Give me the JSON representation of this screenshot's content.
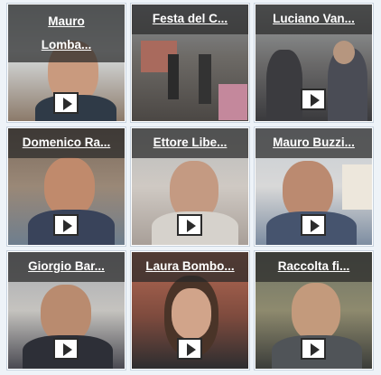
{
  "videos": [
    {
      "title": "Mauro Lomba...",
      "icon": "play-icon"
    },
    {
      "title": "Festa del C...",
      "icon": "play-icon"
    },
    {
      "title": "Luciano Van...",
      "icon": "play-icon"
    },
    {
      "title": "Domenico Ra...",
      "icon": "play-icon"
    },
    {
      "title": "Ettore Libe...",
      "icon": "play-icon"
    },
    {
      "title": "Mauro Buzzi...",
      "icon": "play-icon"
    },
    {
      "title": "Giorgio Bar...",
      "icon": "play-icon"
    },
    {
      "title": "Laura Bombo...",
      "icon": "play-icon"
    },
    {
      "title": "Raccolta fi...",
      "icon": "play-icon"
    }
  ]
}
